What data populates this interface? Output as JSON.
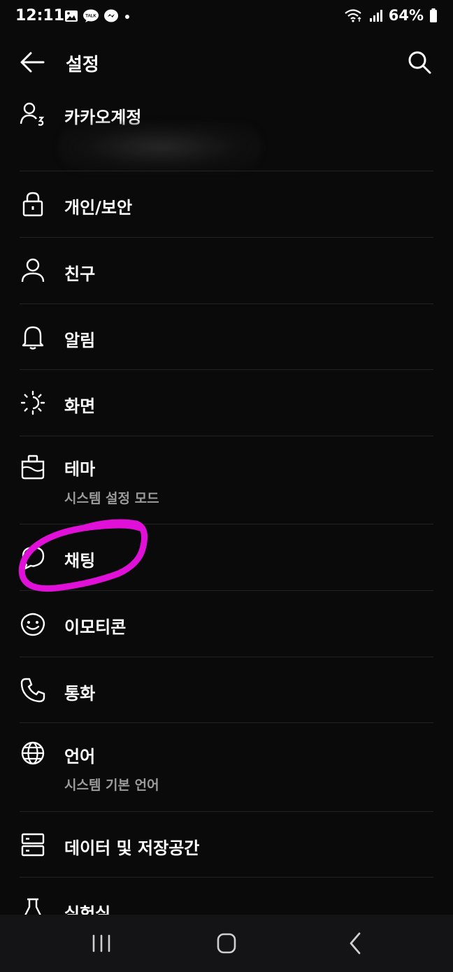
{
  "status_bar": {
    "time": "12:11",
    "left_icons": [
      "gallery-icon",
      "kakaotalk-notification-icon",
      "messenger-icon",
      "dot-indicator"
    ],
    "talk_badge_text": "TALK",
    "right_icons": [
      "wifi-icon",
      "signal-icon",
      "battery-icon"
    ],
    "battery": "64%"
  },
  "header": {
    "title": "설정",
    "back_icon": "back-arrow-icon",
    "search_icon": "search-icon"
  },
  "settings": {
    "items": [
      {
        "label": "카카오계정",
        "icon": "account-icon"
      },
      {
        "label": "개인/보안",
        "icon": "lock-icon"
      },
      {
        "label": "친구",
        "icon": "person-icon"
      },
      {
        "label": "알림",
        "icon": "bell-icon"
      },
      {
        "label": "화면",
        "icon": "brightness-icon"
      },
      {
        "label": "테마",
        "sublabel": "시스템 설정 모드",
        "icon": "theme-icon"
      },
      {
        "label": "채팅",
        "icon": "chat-bubble-icon",
        "highlighted": true
      },
      {
        "label": "이모티콘",
        "icon": "emoticon-icon"
      },
      {
        "label": "통화",
        "icon": "phone-icon"
      },
      {
        "label": "언어",
        "sublabel": "시스템 기본 언어",
        "icon": "globe-icon"
      },
      {
        "label": "데이터 및 저장공간",
        "icon": "storage-icon"
      },
      {
        "label": "실험실",
        "icon": "flask-icon"
      }
    ]
  },
  "annotation": {
    "color": "#e010d8"
  },
  "nav_bar": {
    "buttons": [
      "recent-apps-icon",
      "home-icon",
      "back-icon"
    ]
  }
}
